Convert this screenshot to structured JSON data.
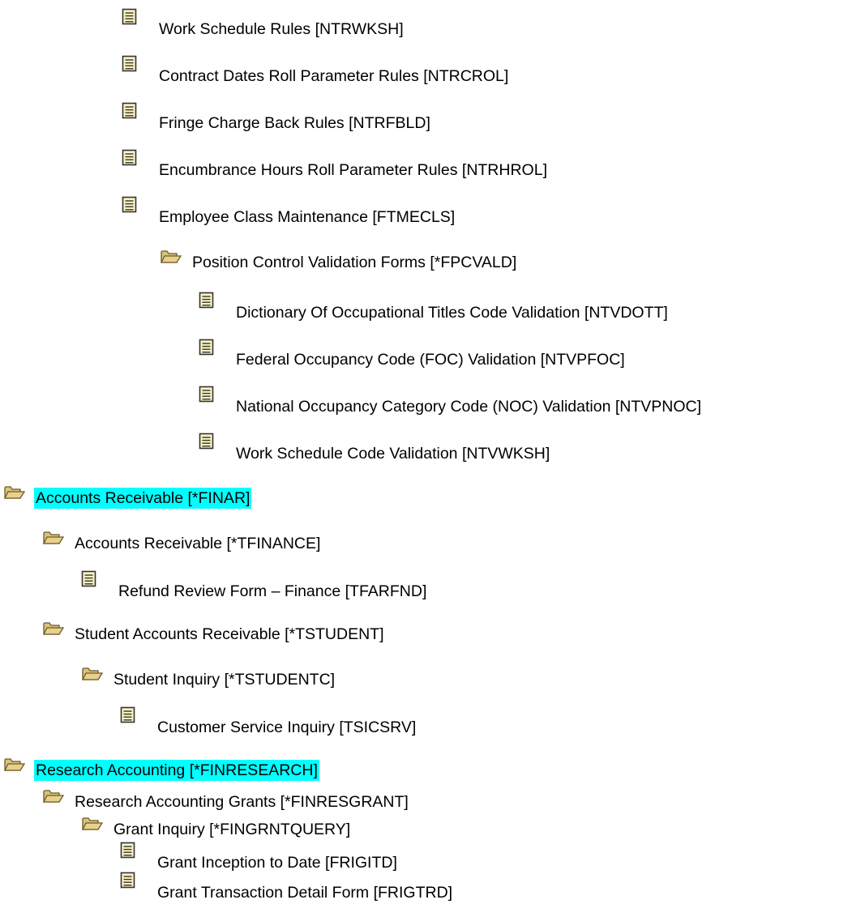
{
  "colors": {
    "highlight": "#00ffff",
    "text": "#000000",
    "folder_fill": "#e8d18a",
    "folder_edge": "#6b5a2a",
    "doc_fill": "#fbf3c0",
    "doc_edge": "#333333"
  },
  "tree": [
    {
      "type": "doc",
      "icon": "document-icon",
      "label": "Work Schedule Rules [NTRWKSH]",
      "highlight": false
    },
    {
      "type": "doc",
      "icon": "document-icon",
      "label": "Contract Dates Roll Parameter Rules [NTRCROL]",
      "highlight": false
    },
    {
      "type": "doc",
      "icon": "document-icon",
      "label": "Fringe Charge Back Rules [NTRFBLD]",
      "highlight": false
    },
    {
      "type": "doc",
      "icon": "document-icon",
      "label": "Encumbrance Hours Roll Parameter Rules [NTRHROL]",
      "highlight": false
    },
    {
      "type": "doc",
      "icon": "document-icon",
      "label": "Employee Class Maintenance [FTMECLS]",
      "highlight": false
    },
    {
      "type": "folder",
      "icon": "folder-open-icon",
      "label": "Position Control Validation Forms [*FPCVALD]",
      "highlight": false
    },
    {
      "type": "doc",
      "icon": "document-icon",
      "label": "Dictionary Of Occupational Titles Code Validation [NTVDOTT]",
      "highlight": false
    },
    {
      "type": "doc",
      "icon": "document-icon",
      "label": "Federal Occupancy Code (FOC) Validation [NTVPFOC]",
      "highlight": false
    },
    {
      "type": "doc",
      "icon": "document-icon",
      "label": "National Occupancy Category Code (NOC) Validation [NTVPNOC]",
      "highlight": false
    },
    {
      "type": "doc",
      "icon": "document-icon",
      "label": "Work Schedule Code Validation [NTVWKSH]",
      "highlight": false
    },
    {
      "type": "folder",
      "icon": "folder-open-icon",
      "label": "Accounts Receivable [*FINAR]",
      "highlight": true
    },
    {
      "type": "folder",
      "icon": "folder-open-icon",
      "label": "Accounts Receivable [*TFINANCE]",
      "highlight": false
    },
    {
      "type": "doc",
      "icon": "document-icon",
      "label": "Refund Review Form – Finance [TFARFND]",
      "highlight": false
    },
    {
      "type": "folder",
      "icon": "folder-open-icon",
      "label": "Student Accounts Receivable [*TSTUDENT]",
      "highlight": false
    },
    {
      "type": "folder",
      "icon": "folder-open-icon",
      "label": "Student Inquiry [*TSTUDENTC]",
      "highlight": false
    },
    {
      "type": "doc",
      "icon": "document-icon",
      "label": "Customer Service Inquiry [TSICSRV]",
      "highlight": false
    },
    {
      "type": "folder",
      "icon": "folder-open-icon",
      "label": "Research Accounting [*FINRESEARCH]",
      "highlight": true
    },
    {
      "type": "folder",
      "icon": "folder-open-icon",
      "label": "Research Accounting Grants [*FINRESGRANT]",
      "highlight": false
    },
    {
      "type": "folder",
      "icon": "folder-open-icon",
      "label": "Grant Inquiry [*FINGRNTQUERY]",
      "highlight": false
    },
    {
      "type": "doc",
      "icon": "document-icon",
      "label": "Grant Inception to Date [FRIGITD]",
      "highlight": false
    },
    {
      "type": "doc",
      "icon": "document-icon",
      "label": "Grant Transaction Detail Form [FRIGTRD]",
      "highlight": false
    }
  ]
}
